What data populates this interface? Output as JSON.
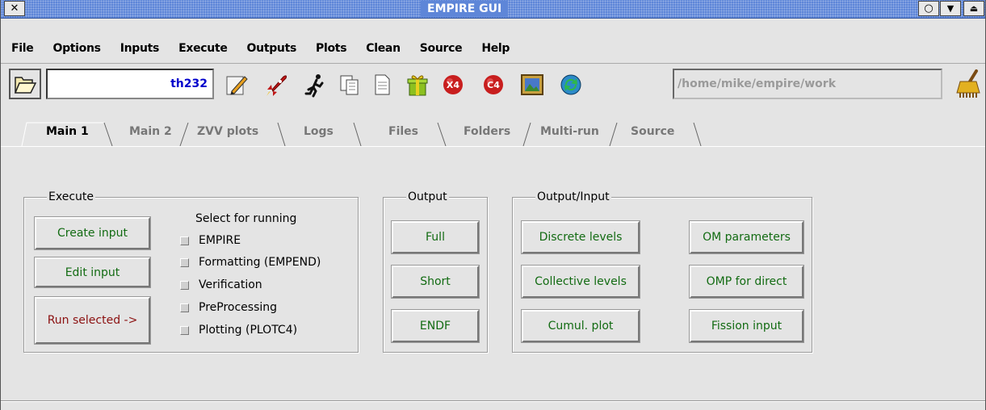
{
  "window": {
    "title": "EMPIRE GUI",
    "close_glyph": "✕",
    "circle_glyph": "○",
    "down_glyph": "▼",
    "eject_glyph": "⏏"
  },
  "menu": [
    "File",
    "Options",
    "Inputs",
    "Execute",
    "Outputs",
    "Plots",
    "Clean",
    "Source",
    "Help"
  ],
  "toolbar": {
    "project_value": "th232",
    "working_dir": "/home/mike/empire/work",
    "x4_label": "X4",
    "c4_label": "C4"
  },
  "tabs": [
    "Main 1",
    "Main 2",
    "ZVV plots",
    "Logs",
    "Files",
    "Folders",
    "Multi-run",
    "Source"
  ],
  "execute_group": {
    "title": "Execute",
    "buttons": [
      "Create input",
      "Edit input",
      "Run selected ->"
    ],
    "select_title": "Select for running",
    "options": [
      "EMPIRE",
      "Formatting (EMPEND)",
      "Verification",
      "PreProcessing",
      "Plotting (PLOTC4)"
    ]
  },
  "output_group": {
    "title": "Output",
    "buttons": [
      "Full",
      "Short",
      "ENDF"
    ]
  },
  "output_input_group": {
    "title": "Output/Input",
    "left_buttons": [
      "Discrete levels",
      "Collective levels",
      "Cumul. plot"
    ],
    "right_buttons": [
      "OM parameters",
      "OMP for direct",
      "Fission input"
    ]
  },
  "colors": {
    "titlebar": "#5e86d8",
    "button_text_green": "#126b12",
    "button_text_red": "#8b1010",
    "project_value_blue": "#0000cc"
  }
}
